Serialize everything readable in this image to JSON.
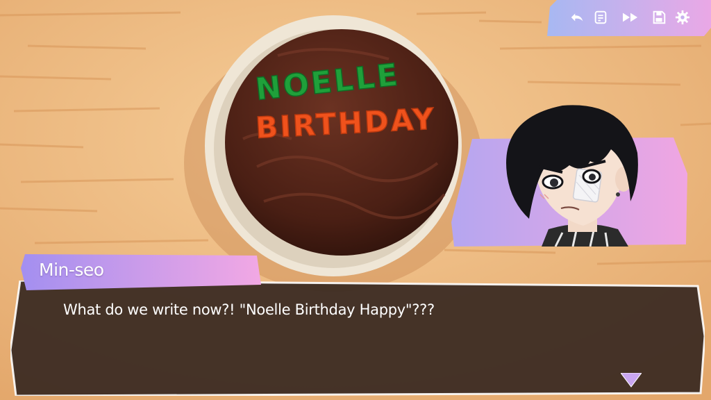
{
  "scene": {
    "cake_line1": "NOELLE",
    "cake_line2": "BIRTHDAY",
    "colors": {
      "table": "#e9b57c",
      "cake": "#4a1f14",
      "frosting_green": "#1fa03a",
      "frosting_orange": "#f0521c"
    }
  },
  "toolbar": {
    "buttons": [
      {
        "icon": "rewind-icon"
      },
      {
        "icon": "history-log-icon"
      },
      {
        "icon": "fast-forward-icon"
      },
      {
        "icon": "save-icon"
      },
      {
        "icon": "gear-icon"
      }
    ],
    "colors": {
      "from": "#a7b8f2",
      "to": "#eaa8e6",
      "icon": "#ffffff"
    }
  },
  "dialogue": {
    "speaker": "Min-seo",
    "text": "What do we write now?! \"Noelle Birthday Happy\"???",
    "colors": {
      "namebox_from": "#a38ff0",
      "namebox_to": "#f2a8e4",
      "box": "#3a2a22"
    }
  }
}
